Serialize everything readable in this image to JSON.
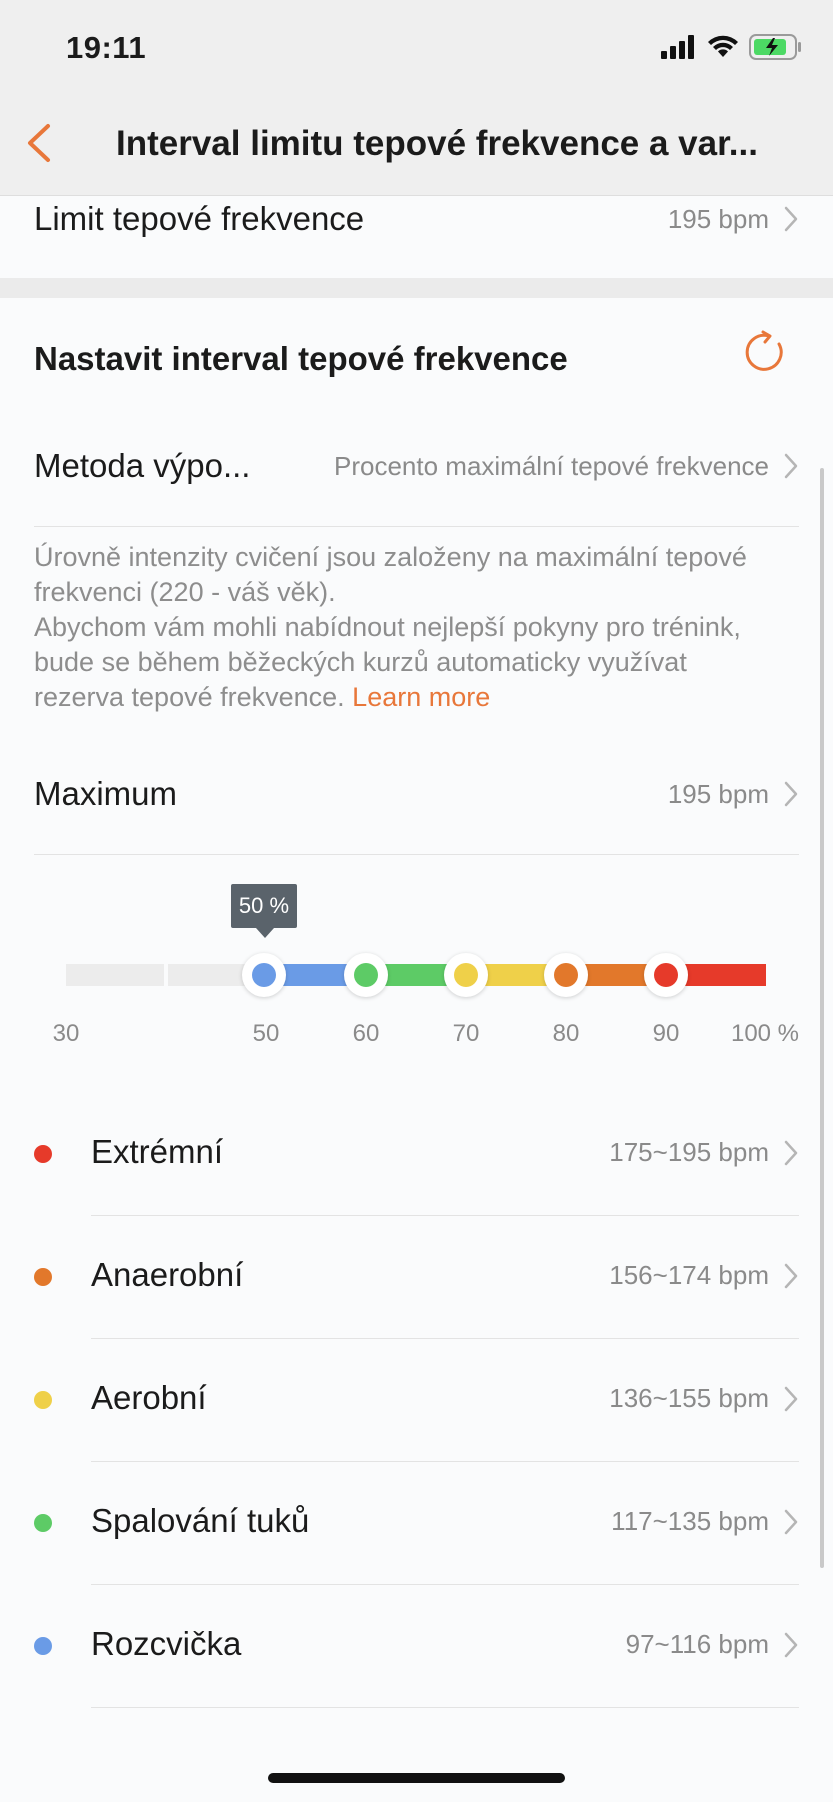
{
  "status_bar": {
    "time": "19:11"
  },
  "nav": {
    "title": "Interval limitu tepové frekvence a var..."
  },
  "limit_row": {
    "label": "Limit tepové frekvence",
    "value": "195 bpm"
  },
  "section": {
    "title": "Nastavit interval tepové frekvence",
    "method_label": "Metoda výpo...",
    "method_value": "Procento maximální tepové frekvence",
    "description_line1": "Úrovně intenzity cvičení jsou založeny na maximální tepové frekvenci (220 - váš věk).",
    "description_line2": "Abychom vám mohli nabídnout nejlepší pokyny pro trénink, bude se během běžeckých kurzů automaticky využívat rezerva tepové frekvence. ",
    "learn_more": "Learn more",
    "maximum_label": "Maximum",
    "maximum_value": "195 bpm"
  },
  "slider": {
    "tooltip": "50 %",
    "ticks": [
      "30",
      "50",
      "60",
      "70",
      "80",
      "90",
      "100 %"
    ],
    "thresholds_percent": [
      50,
      60,
      70,
      80,
      90
    ],
    "colors": {
      "inactive": "#ececec",
      "warmup": "#6a9be6",
      "fatburn": "#5dcb66",
      "aerobic": "#efd049",
      "anaerobic": "#e2782b",
      "extreme": "#e63a2a"
    }
  },
  "zones": [
    {
      "label": "Extrémní",
      "value": "175~195 bpm",
      "color": "#e63a2a"
    },
    {
      "label": "Anaerobní",
      "value": "156~174 bpm",
      "color": "#e2782b"
    },
    {
      "label": "Aerobní",
      "value": "136~155 bpm",
      "color": "#efd049"
    },
    {
      "label": "Spalování tuků",
      "value": "117~135 bpm",
      "color": "#5dcb66"
    },
    {
      "label": "Rozcvička",
      "value": "97~116 bpm",
      "color": "#6a9be6"
    }
  ],
  "accent": "#e8773a"
}
